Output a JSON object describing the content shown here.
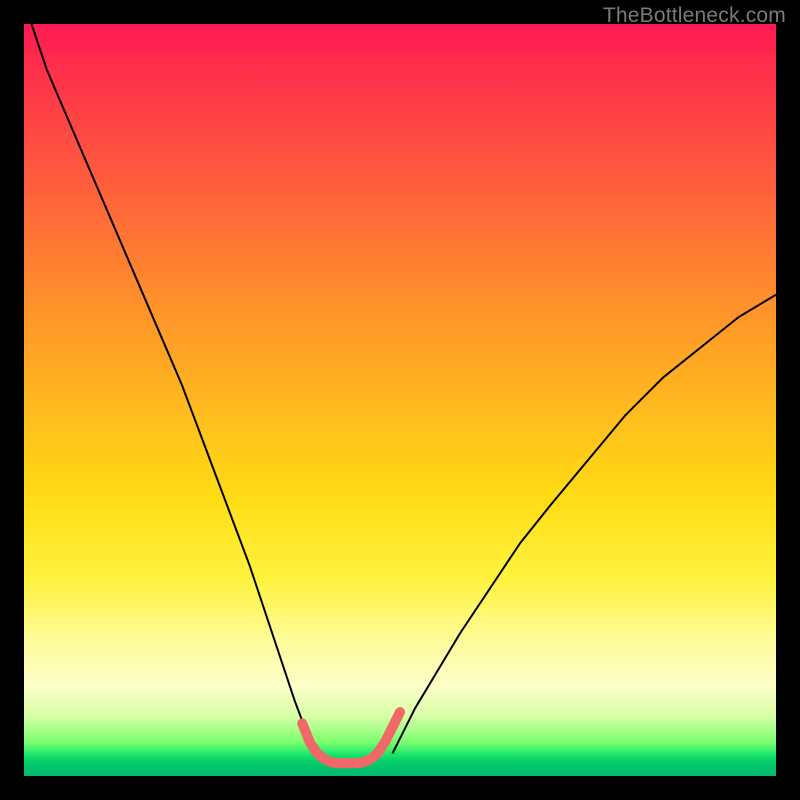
{
  "watermark": "TheBottleneck.com",
  "chart_data": {
    "type": "line",
    "title": "",
    "xlabel": "",
    "ylabel": "",
    "xlim": [
      0,
      100
    ],
    "ylim": [
      0,
      100
    ],
    "grid": false,
    "legend": null,
    "annotations": [],
    "series": [
      {
        "name": "bottleneck-curve-left",
        "stroke": "#000000",
        "width": 2,
        "x": [
          1,
          3,
          6,
          9,
          12,
          15,
          18,
          21,
          24,
          27,
          30,
          32,
          34,
          36,
          37.5,
          38.5
        ],
        "y": [
          100,
          94,
          87,
          80,
          73,
          66,
          59,
          52,
          44,
          36,
          28,
          22,
          16,
          10,
          6,
          3
        ]
      },
      {
        "name": "bottleneck-curve-right",
        "stroke": "#000000",
        "width": 2,
        "x": [
          49,
          50,
          52,
          55,
          58,
          62,
          66,
          70,
          75,
          80,
          85,
          90,
          95,
          100
        ],
        "y": [
          3,
          5,
          9,
          14,
          19,
          25,
          31,
          36,
          42,
          48,
          53,
          57,
          61,
          64
        ]
      },
      {
        "name": "bottleneck-floor-highlight",
        "stroke": "#f06868",
        "width": 10,
        "cap": "round",
        "x": [
          37,
          38,
          39,
          40,
          41,
          42,
          43,
          44,
          45,
          46,
          47,
          48,
          49,
          50
        ],
        "y": [
          7,
          4.5,
          3,
          2.2,
          1.8,
          1.7,
          1.7,
          1.7,
          1.8,
          2.2,
          3,
          4.5,
          6.5,
          8.5
        ]
      }
    ],
    "background_gradient": {
      "direction": "vertical",
      "stops": [
        {
          "pos": 0.0,
          "color": "#ff1a52"
        },
        {
          "pos": 0.35,
          "color": "#ff8a2d"
        },
        {
          "pos": 0.63,
          "color": "#ffdc14"
        },
        {
          "pos": 0.88,
          "color": "#fdffc8"
        },
        {
          "pos": 0.97,
          "color": "#22e86a"
        },
        {
          "pos": 1.0,
          "color": "#00b96c"
        }
      ]
    }
  }
}
